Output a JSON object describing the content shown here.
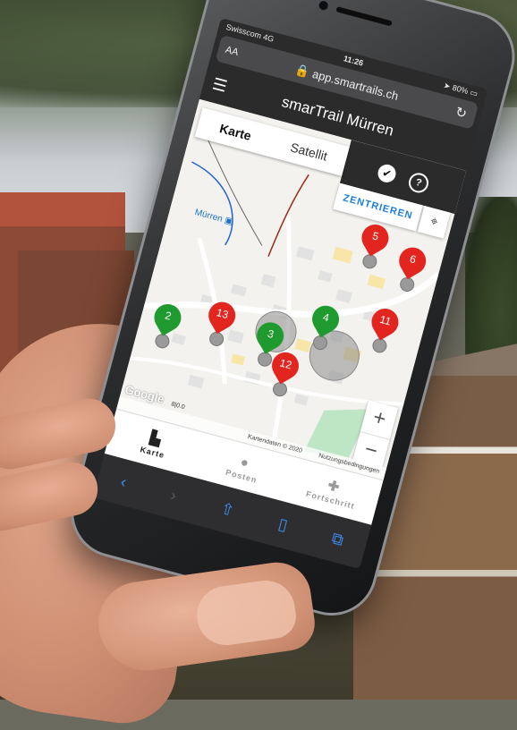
{
  "status": {
    "carrier": "Swisscom 4G",
    "time": "11:26",
    "battery": "80%"
  },
  "browser": {
    "text_size": "AA",
    "url": "app.smartrails.ch",
    "reload_icon": "reload-icon"
  },
  "app": {
    "title": "smarTrail Mürren",
    "menu_icon": "hamburger-icon"
  },
  "map": {
    "tabs": [
      {
        "label": "Karte",
        "active": true
      },
      {
        "label": "Satellit",
        "active": false
      }
    ],
    "center_button": "ZENTRIEREN",
    "place_label": "Mürren",
    "google": "Google",
    "scale": "8|0.0",
    "attribution": "Kartendaten © 2020",
    "terms": "Nutzungsbedingungen",
    "zoom_in": "+",
    "zoom_out": "−",
    "markers": [
      {
        "number": "2",
        "color": "green"
      },
      {
        "number": "13",
        "color": "red"
      },
      {
        "number": "3",
        "color": "green"
      },
      {
        "number": "4",
        "color": "green"
      },
      {
        "number": "12",
        "color": "red"
      },
      {
        "number": "11",
        "color": "red"
      },
      {
        "number": "5",
        "color": "red"
      },
      {
        "number": "6",
        "color": "red"
      }
    ]
  },
  "nav": [
    {
      "label": "Karte",
      "icon": "map-icon",
      "active": true
    },
    {
      "label": "Posten",
      "icon": "pin-icon",
      "active": false
    },
    {
      "label": "Fortschritt",
      "icon": "progress-icon",
      "active": false
    }
  ],
  "colors": {
    "accent": "#1e7fd8",
    "marker_red": "#e2261f",
    "marker_green": "#1f9a2e",
    "header": "#2b2b2b"
  }
}
